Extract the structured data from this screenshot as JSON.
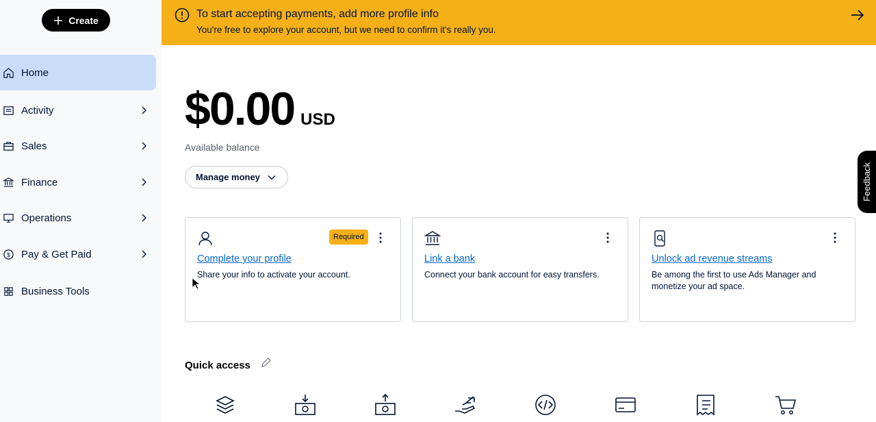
{
  "sidebar": {
    "create_label": "Create",
    "items": [
      {
        "label": "Home",
        "icon": "home-icon",
        "active": true
      },
      {
        "label": "Activity",
        "icon": "activity-icon"
      },
      {
        "label": "Sales",
        "icon": "briefcase-icon"
      },
      {
        "label": "Finance",
        "icon": "bank-icon"
      },
      {
        "label": "Operations",
        "icon": "monitor-icon"
      },
      {
        "label": "Pay & Get Paid",
        "icon": "dollar-cycle-icon"
      },
      {
        "label": "Business Tools",
        "icon": "grid-icon"
      }
    ]
  },
  "banner": {
    "title": "To start accepting payments, add more profile info",
    "subtitle": "You're free to explore your account, but we need to confirm it's really you.",
    "color": "#f5b017"
  },
  "balance": {
    "amount": "$0.00",
    "currency": "USD",
    "label": "Available balance",
    "manage_label": "Manage money"
  },
  "feedback_label": "Feedback",
  "cards": [
    {
      "icon": "person-icon",
      "badge": "Required",
      "link": "Complete your profile",
      "description": "Share your info to activate your account."
    },
    {
      "icon": "bank-icon",
      "link": "Link a bank",
      "description": "Connect your bank account for easy transfers."
    },
    {
      "icon": "phone-search-icon",
      "link": "Unlock ad revenue streams",
      "description": "Be among the first to use Ads Manager and monetize your ad space."
    }
  ],
  "quick_access": {
    "title": "Quick access",
    "items": [
      "layers-icon",
      "cash-in-icon",
      "cash-out-icon",
      "hand-send-icon",
      "code-icon",
      "card-icon",
      "invoice-icon",
      "cart-icon"
    ]
  },
  "colors": {
    "accent": "#f5b017",
    "link": "#0b67d0",
    "active_nav": "#c9ddf9"
  }
}
